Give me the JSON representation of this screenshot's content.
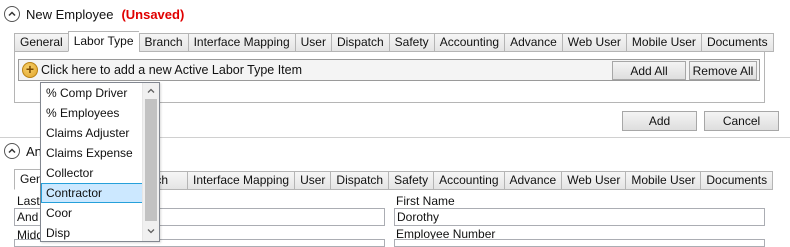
{
  "panel1": {
    "title": "New Employee",
    "status": "(Unsaved)",
    "tabs": [
      "General",
      "Labor Type",
      "Branch",
      "Interface Mapping",
      "User",
      "Dispatch",
      "Safety",
      "Accounting",
      "Advance",
      "Web User",
      "Mobile User",
      "Documents"
    ],
    "active_tab": "Labor Type",
    "add_item_text": "Click here to add a new Active Labor Type Item",
    "add_all_label": "Add All",
    "remove_all_label": "Remove All",
    "add_label": "Add",
    "cancel_label": "Cancel"
  },
  "dropdown": {
    "items": [
      "% Comp Driver",
      "% Employees",
      "Claims Adjuster",
      "Claims Expense",
      "Collector",
      "Contractor",
      "Coor",
      "Disp"
    ],
    "selected": "Contractor"
  },
  "panel2": {
    "title_visible": "An",
    "tabs": [
      "Gen",
      "anch",
      "Interface Mapping",
      "User",
      "Dispatch",
      "Safety",
      "Accounting",
      "Advance",
      "Web User",
      "Mobile User",
      "Documents"
    ],
    "last_label_visible": "Last",
    "last_value_visible": "And",
    "middle_label_visible": "Midd",
    "first_name_label": "First Name",
    "first_name_value": "Dorothy",
    "employee_number_label": "Employee Number"
  },
  "colors": {
    "unsaved": "#e00000",
    "selection": "#cce8ff",
    "selection_border": "#26a0da",
    "add_icon": "#e0a42a"
  },
  "icons": {
    "collapse": "chevron-up-icon",
    "add": "plus-icon",
    "scroll_up": "chevron-up-icon",
    "scroll_down": "chevron-down-icon"
  }
}
